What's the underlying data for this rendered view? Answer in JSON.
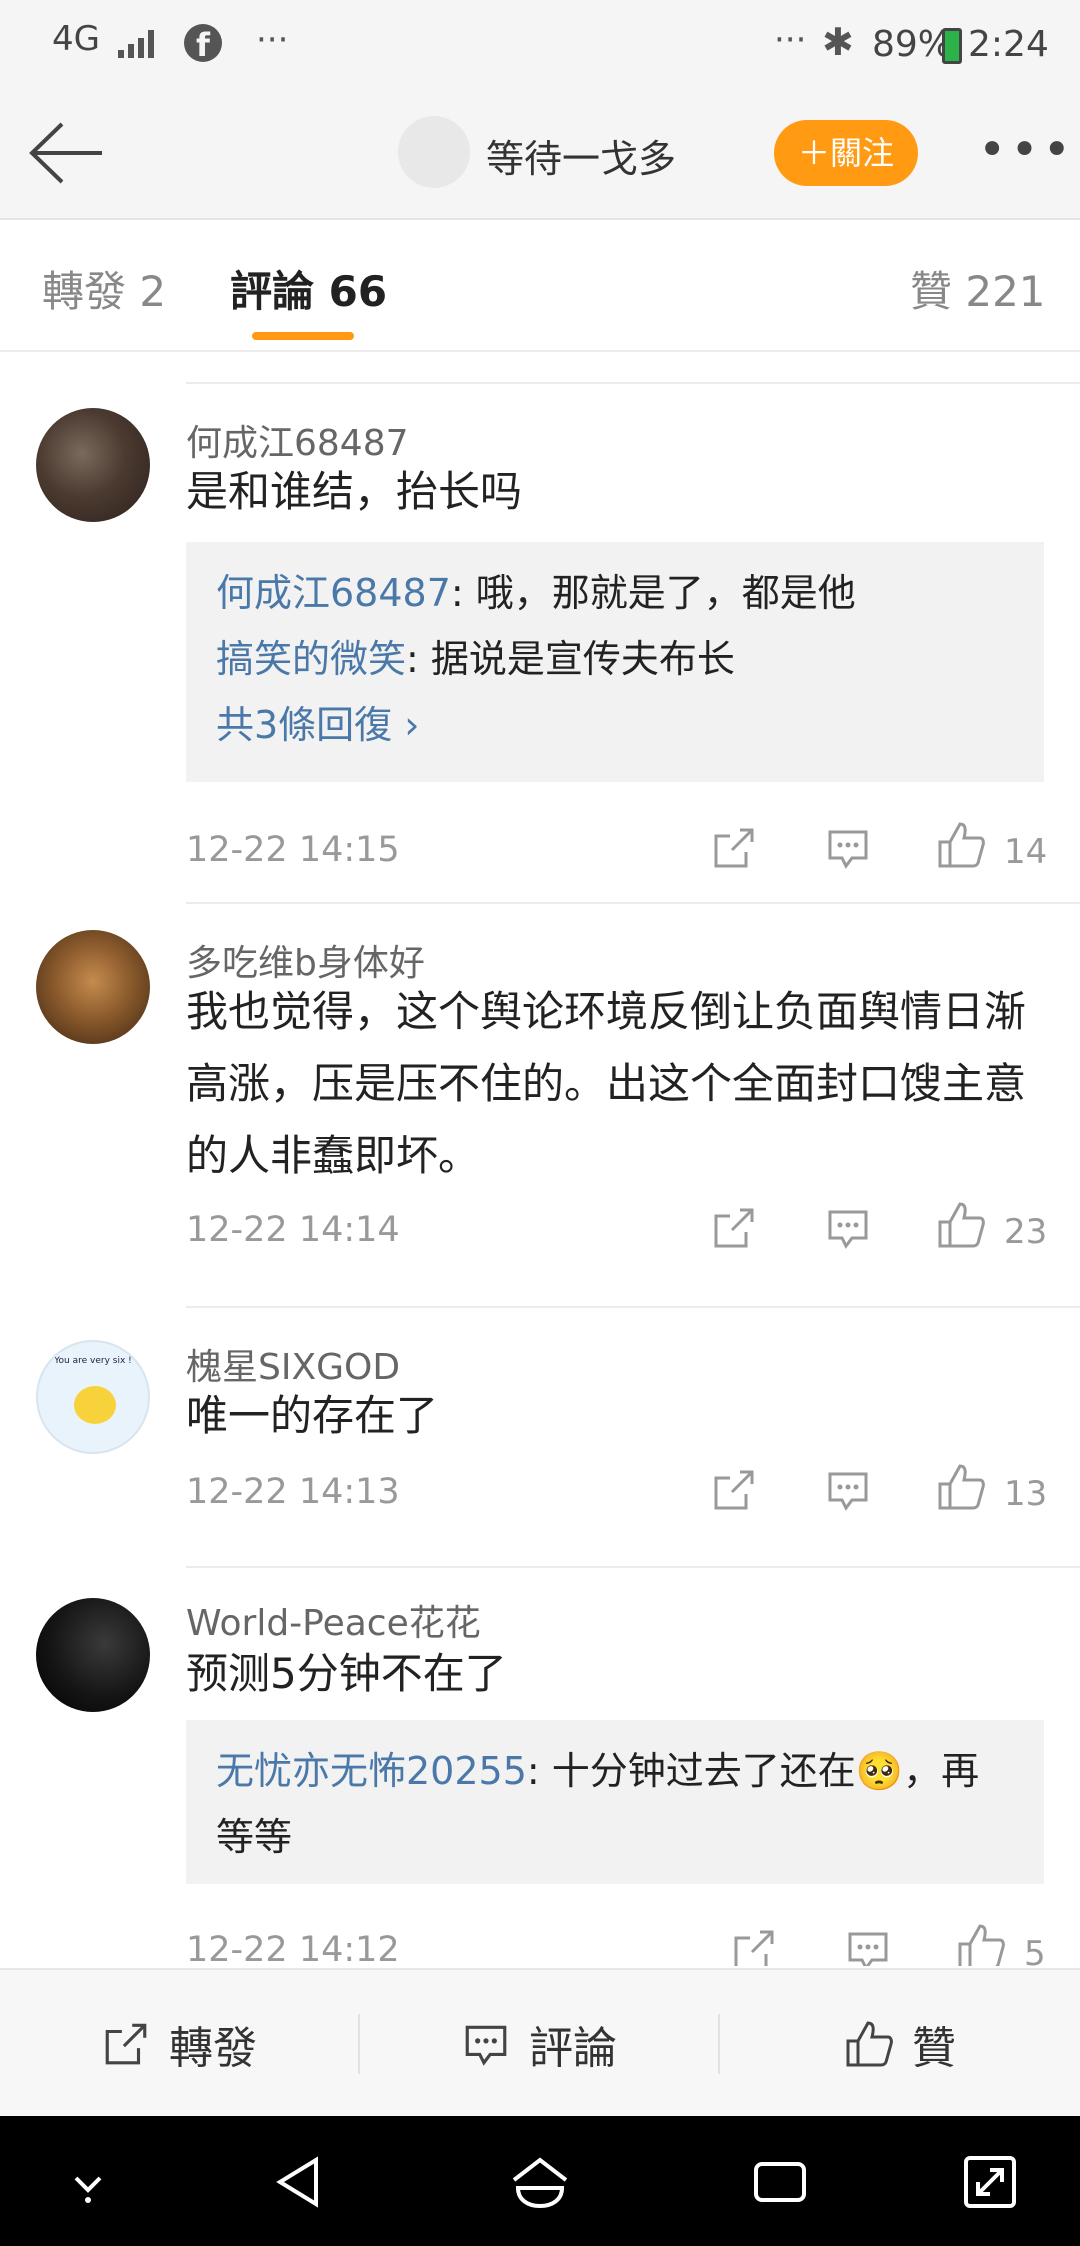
{
  "status_bar": {
    "network": "4G",
    "dots_left": "···",
    "dots_right": "···",
    "battery_pct": "89%",
    "time": "2:24"
  },
  "header": {
    "user_name": "等待一戈多",
    "follow_label": "＋關注",
    "more_label": "•••"
  },
  "tabs": {
    "repost": "轉發 2",
    "comments": "評論 66",
    "likes": "贊 221"
  },
  "comments": [
    {
      "user": "何成江68487",
      "text": "是和谁结，抬长吗",
      "replies": [
        {
          "user": "何成江68487",
          "text": ": 哦，那就是了，都是他"
        },
        {
          "user": "搞笑的微笑",
          "text": ": 据说是宣传夫布长"
        }
      ],
      "more_replies": "共3條回復 ›",
      "time": "12-22 14:15",
      "likes": "14"
    },
    {
      "user": "多吃维b身体好",
      "text": "我也觉得，这个舆论环境反倒让负面舆情日渐高涨，压是压不住的。出这个全面封口馊主意的人非蠢即坏。",
      "time": "12-22 14:14",
      "likes": "23"
    },
    {
      "user": "槐星SIXGOD",
      "text": "唯一的存在了",
      "time": "12-22 14:13",
      "likes": "13",
      "avatar_text": "You are very six !"
    },
    {
      "user": "World-Peace花花",
      "text": "预测5分钟不在了",
      "replies": [
        {
          "user": "无忧亦无怖20255",
          "text": ": 十分钟过去了还在🥺，再等等"
        }
      ],
      "time": "12-22 14:12",
      "likes": "5"
    }
  ],
  "bottom_bar": {
    "repost": "轉發",
    "comment": "評論",
    "like": "贊"
  },
  "colors": {
    "accent": "#ff9a12",
    "link": "#4a78a8"
  }
}
